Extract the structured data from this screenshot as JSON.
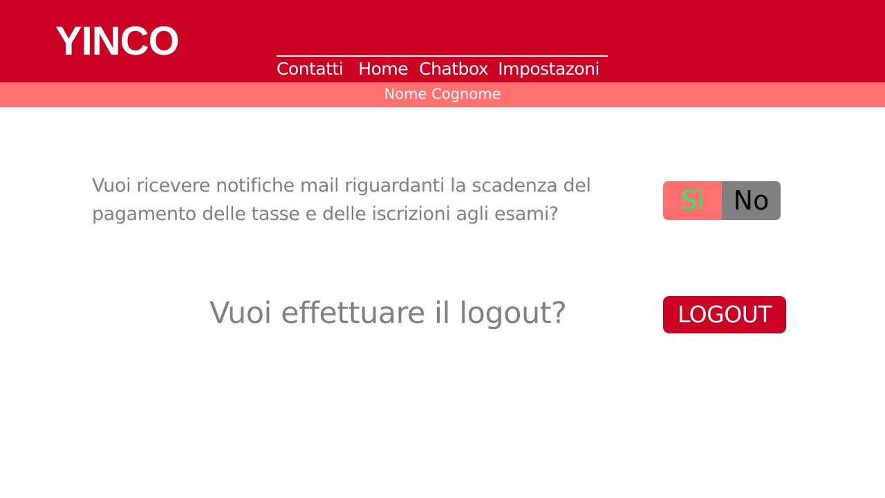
{
  "colors": {
    "header_bg": "#cc0022",
    "userbar_bg": "#ff7070",
    "question_text": "#808080",
    "toggle_yes_bg": "#ff7070",
    "toggle_yes_text": "#22ee66",
    "toggle_no_bg": "#808080",
    "logout_bg": "#cc0022"
  },
  "header": {
    "logo": "YINCO",
    "nav": [
      {
        "label": "Contatti"
      },
      {
        "label": "Home"
      },
      {
        "label": "Chatbox"
      },
      {
        "label": "Impostazoni"
      }
    ]
  },
  "user": {
    "name": "Nome Cognome"
  },
  "settings": {
    "notifications_question": "Vuoi ricevere notifiche mail riguardanti la scadenza del pagamento delle tasse e delle iscrizioni agli esami?",
    "toggle_yes": "Sì",
    "toggle_no": "No",
    "logout_question": "Vuoi effettuare il logout?",
    "logout_label": "LOGOUT"
  }
}
